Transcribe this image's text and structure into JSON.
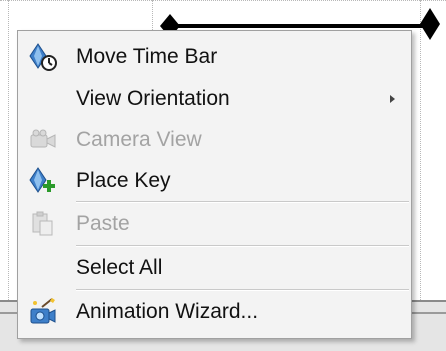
{
  "context_menu": {
    "items": [
      {
        "label": "Move Time Bar",
        "icon": "key-clock-icon",
        "enabled": true,
        "submenu": false
      },
      {
        "label": "View Orientation",
        "icon": "",
        "enabled": true,
        "submenu": true
      },
      {
        "label": "Camera View",
        "icon": "camera-icon",
        "enabled": false,
        "submenu": false
      },
      {
        "label": "Place Key",
        "icon": "key-add-icon",
        "enabled": true,
        "submenu": false
      },
      {
        "label": "Paste",
        "icon": "paste-icon",
        "enabled": false,
        "submenu": false
      },
      {
        "label": "Select All",
        "icon": "",
        "enabled": true,
        "submenu": false
      },
      {
        "label": "Animation Wizard...",
        "icon": "animation-wizard-icon",
        "enabled": true,
        "submenu": false
      }
    ]
  },
  "colors": {
    "menu_background": "#f3f3f3",
    "key_blue": "#3e7fc9",
    "disabled_text": "#a3a3a3",
    "enabled_text": "#111111"
  }
}
